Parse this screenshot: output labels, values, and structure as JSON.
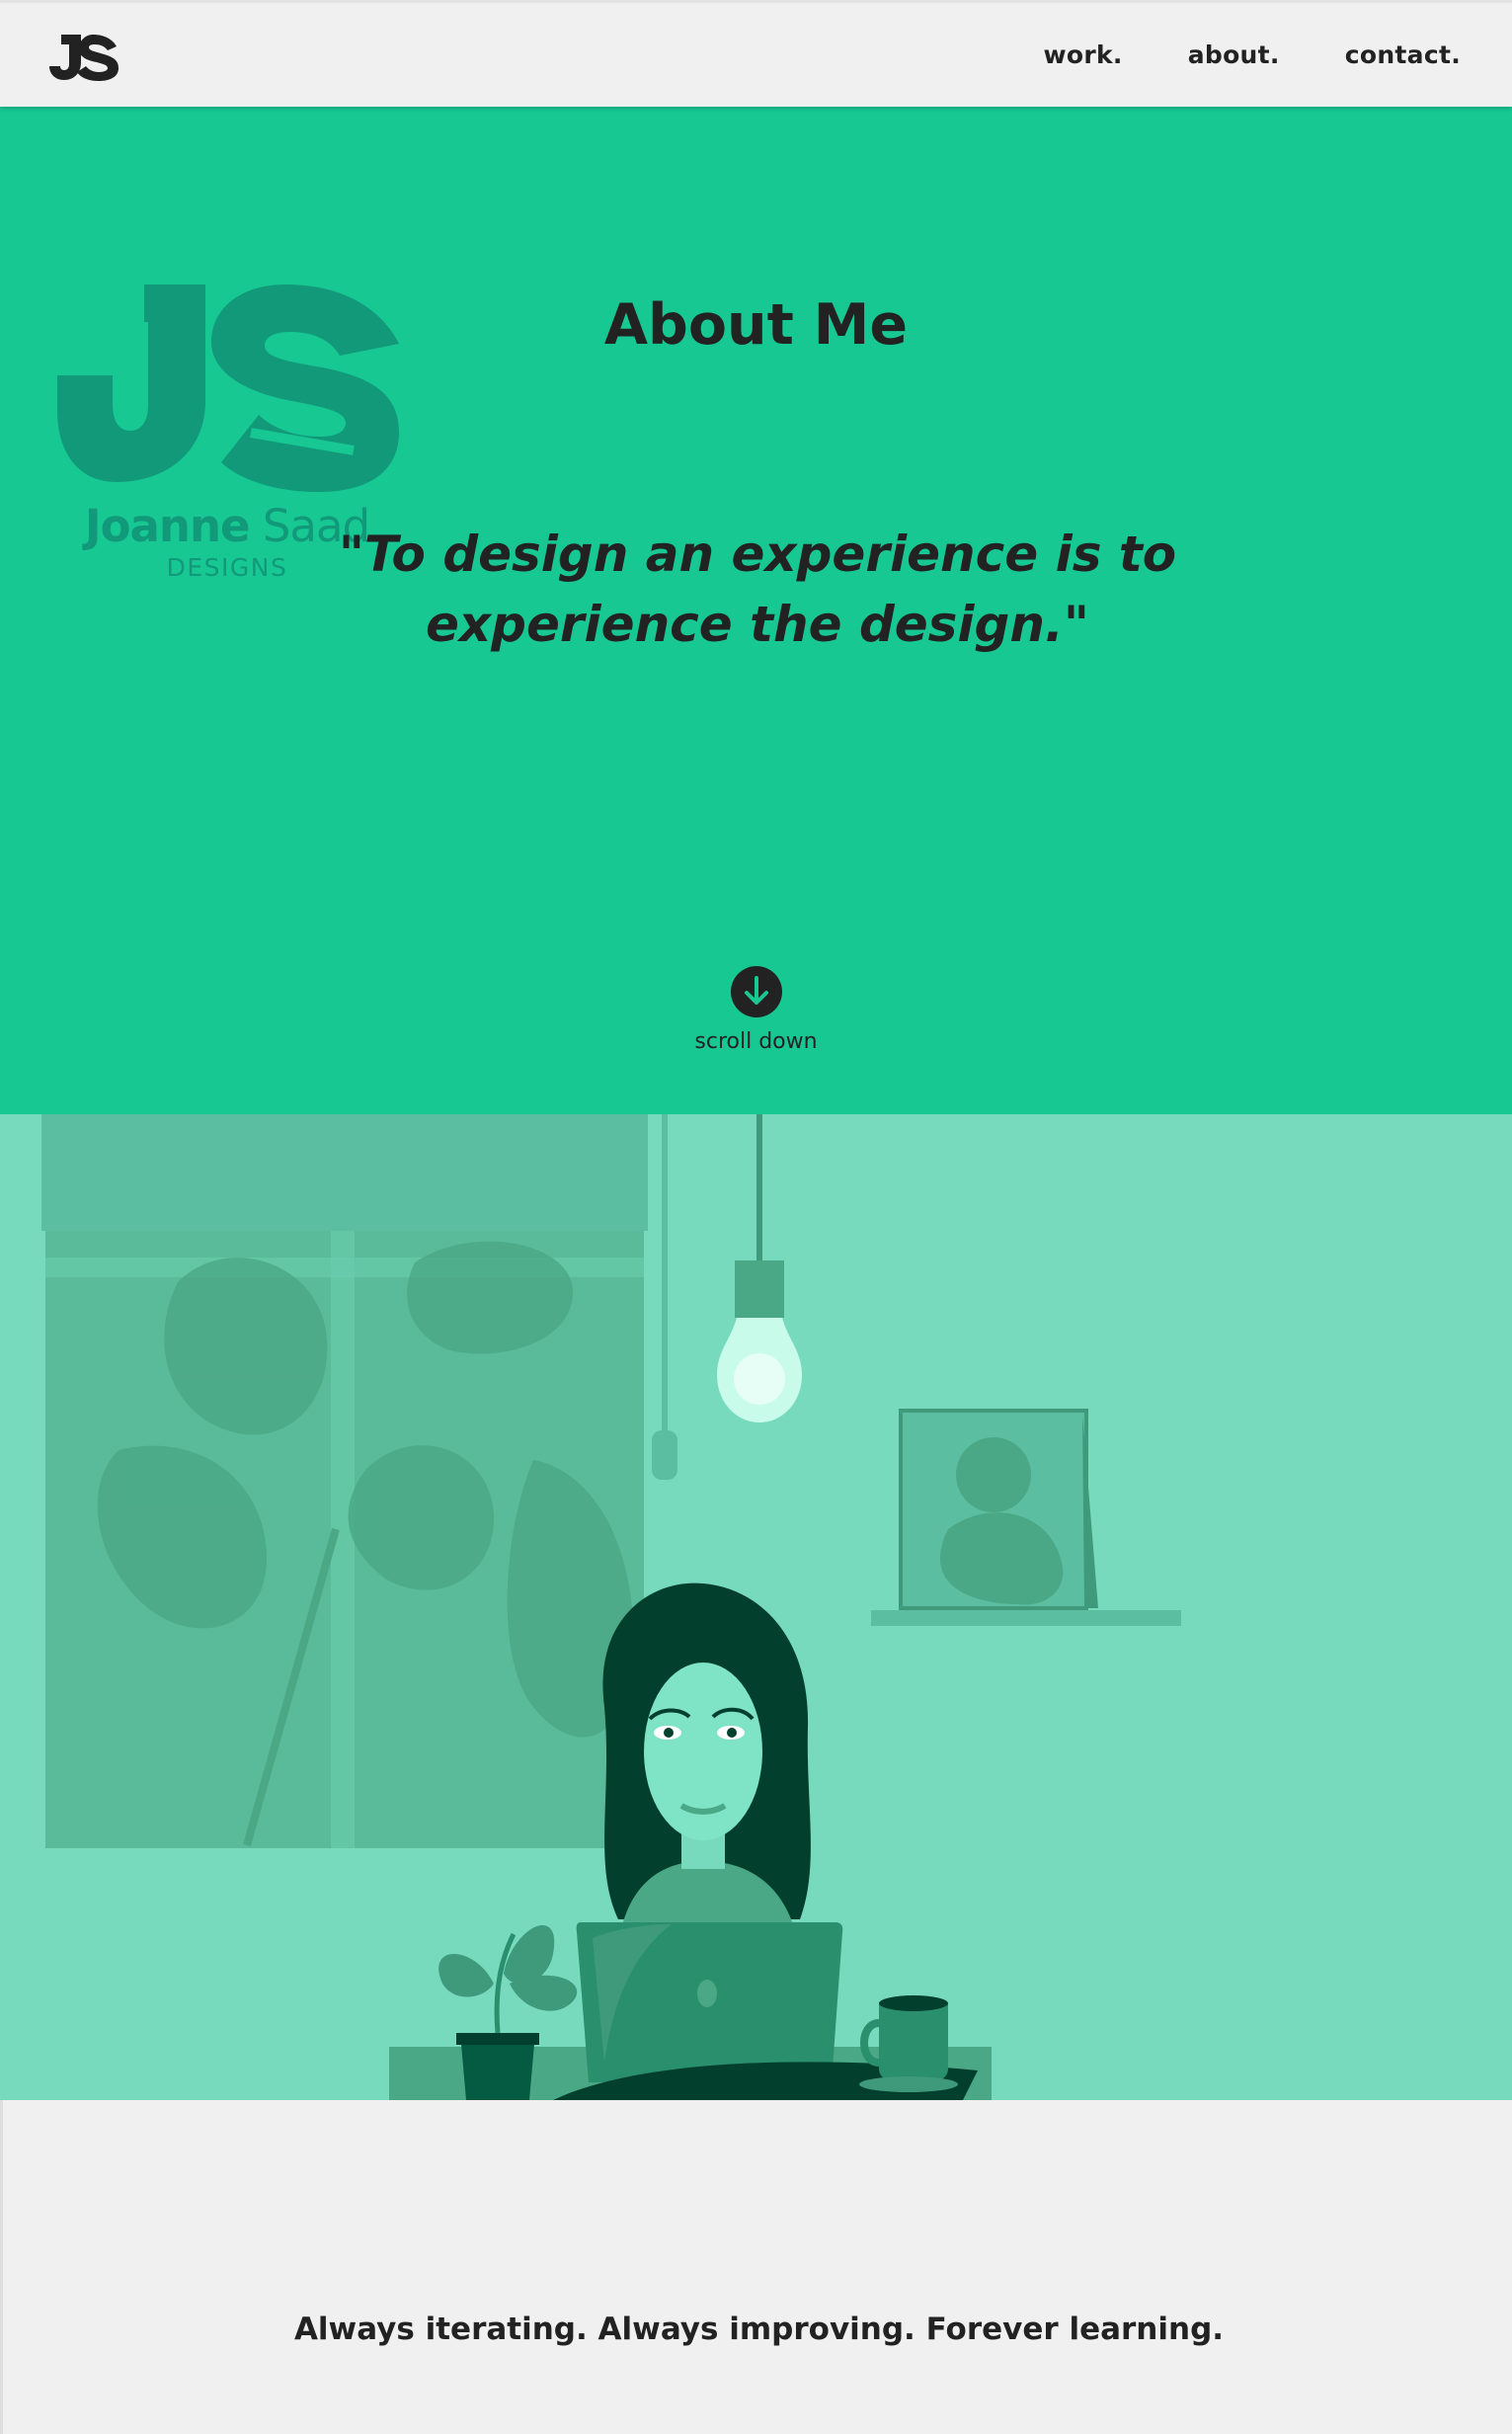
{
  "header": {
    "logo_text": "JS",
    "nav": [
      {
        "label": "work."
      },
      {
        "label": "about."
      },
      {
        "label": "contact."
      }
    ]
  },
  "hero": {
    "brand_first": "Joanne",
    "brand_last": "Saad",
    "brand_sub": "DESIGNS",
    "title": "About Me",
    "quote": "\"To design an experience is to experience the design.\"",
    "scroll_label": "scroll down"
  },
  "illustration": {
    "description_icon": "designer-at-laptop-illustration"
  },
  "footer": {
    "tagline": "Always iterating. Always improving. Forever learning."
  },
  "colors": {
    "hero_bg": "#17c893",
    "illustration_bg": "#78dabd",
    "text": "#222222",
    "brand": "#11997a"
  }
}
